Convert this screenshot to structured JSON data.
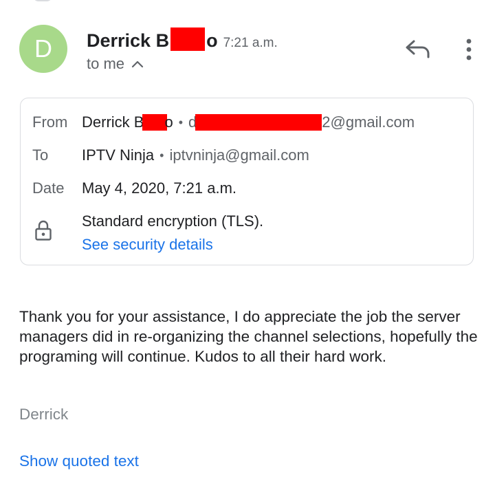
{
  "colors": {
    "avatar_bg": "#a8d98a",
    "link": "#1a73e8",
    "redaction": "#ff0000"
  },
  "icons": [
    "chevron-up-icon",
    "reply-icon",
    "more-vert-icon",
    "lock-icon"
  ],
  "header": {
    "avatar_letter": "D",
    "sender_name_start": "Derrick B",
    "sender_name_end": "o",
    "time": "7:21 a.m.",
    "recipient_toggle": "to me"
  },
  "details": {
    "from_label": "From",
    "from_name_start": "Derrick B",
    "from_name_end": "o",
    "from_email_start": "d",
    "from_email_end": "2@gmail.com",
    "to_label": "To",
    "to_name": "IPTV Ninja",
    "to_email": "iptvninja@gmail.com",
    "date_label": "Date",
    "date_value": "May 4, 2020, 7:21 a.m.",
    "encryption_text": "Standard encryption (TLS).",
    "security_link": "See security details",
    "separator": "•"
  },
  "message": {
    "body": "Thank you for your assistance, I do appreciate the job the server managers did in re-organizing the channel selections, hopefully the programing will continue. Kudos to all their hard work.",
    "signature": "Derrick",
    "quoted_link": "Show quoted text"
  }
}
